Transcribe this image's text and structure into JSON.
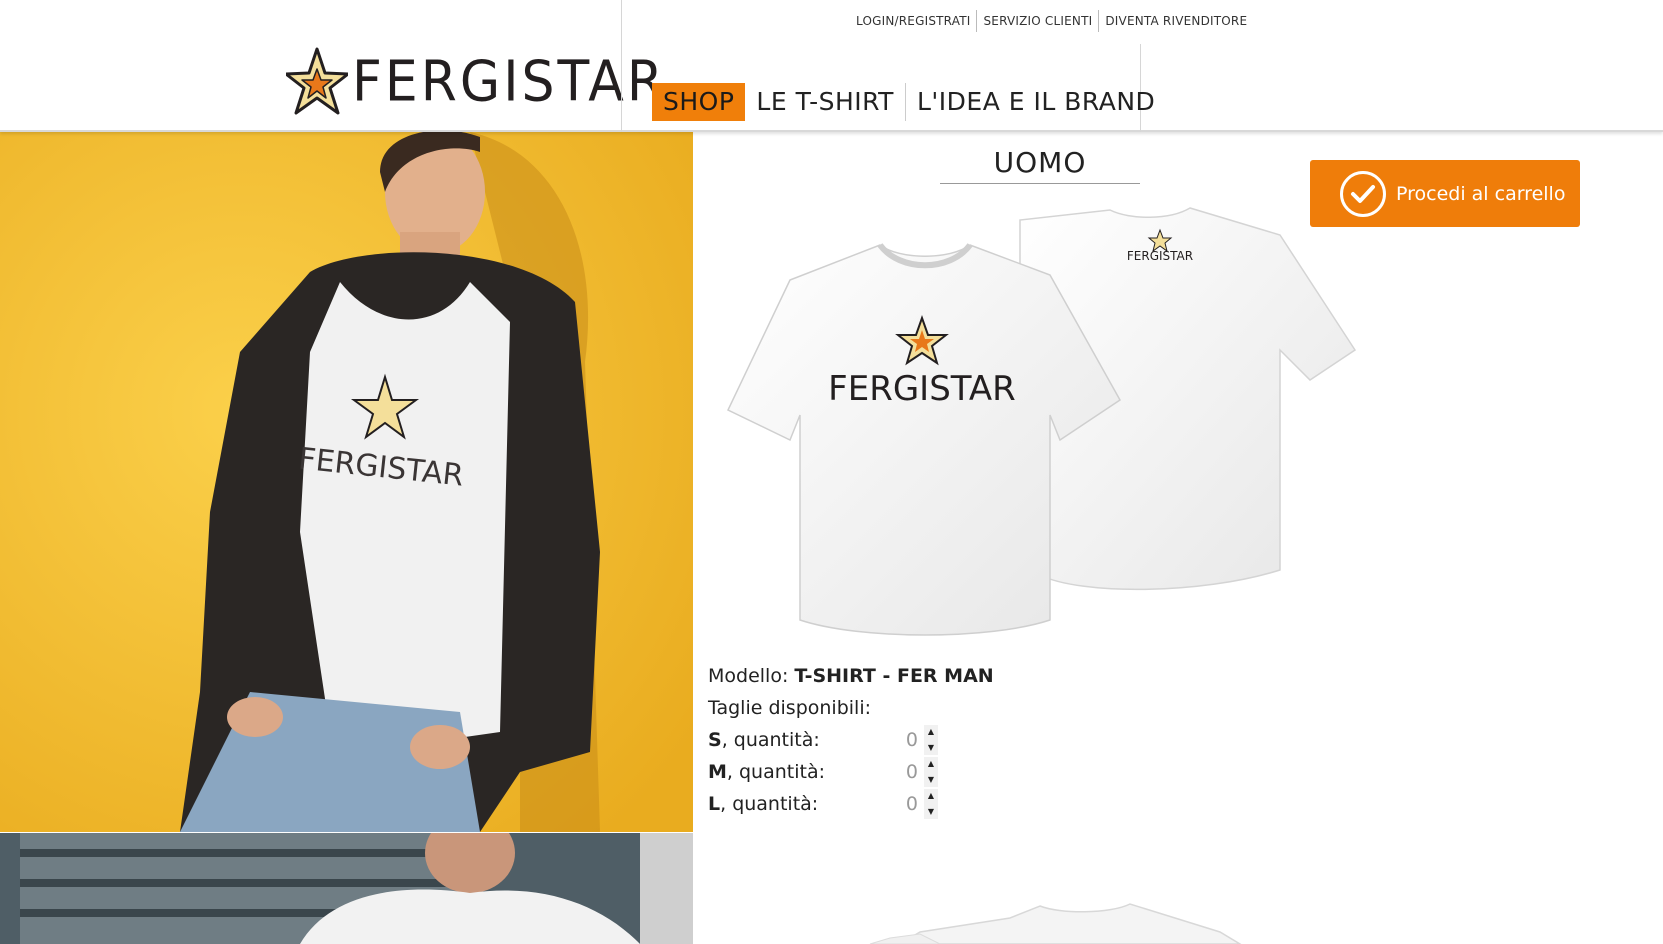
{
  "header": {
    "brand": "FERGISTAR",
    "toplinks": [
      "LOGIN/REGISTRATI",
      "SERVIZIO CLIENTI",
      "DIVENTA RIVENDITORE"
    ],
    "nav": [
      {
        "label": "SHOP",
        "active": true
      },
      {
        "label": "LE T-SHIRT",
        "active": false
      },
      {
        "label": "L'IDEA E IL BRAND",
        "active": false
      }
    ]
  },
  "product": {
    "category": "UOMO",
    "cart_button": "Procedi al carrello",
    "tshirt_print_front": "FERGISTAR",
    "tshirt_print_back": "FERGISTAR",
    "model_label": "Modello:",
    "model_value": "T-SHIRT - FER MAN",
    "sizes_label": "Taglie disponibili:",
    "sizes": [
      {
        "size": "S",
        "suffix": ", quantità:",
        "qty": "0"
      },
      {
        "size": "M",
        "suffix": ", quantità:",
        "qty": "0"
      },
      {
        "size": "L",
        "suffix": ", quantità:",
        "qty": "0"
      }
    ]
  },
  "photo_caption_print": "FERGISTAR",
  "colors": {
    "accent": "#ef7d0a",
    "photo_background": "#f7c232"
  }
}
